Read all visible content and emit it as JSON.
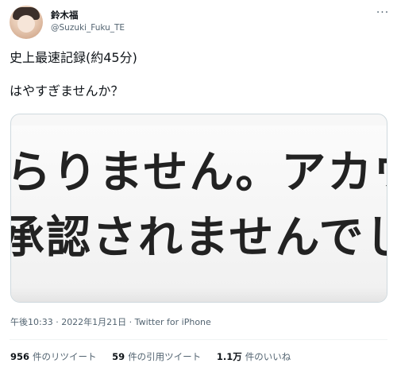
{
  "user": {
    "display_name": "鈴木福",
    "handle": "@Suzuki_Fuku_TE"
  },
  "more_glyph": "···",
  "tweet": {
    "lines": [
      "史上最速記録(約45分)",
      "はやすぎませんか？"
    ]
  },
  "media": {
    "line1": "らりません。アカウン",
    "line2": "承認されませんでした"
  },
  "meta": {
    "timestamp": "午後10:33 · 2022年1月21日 · Twitter for iPhone"
  },
  "stats": {
    "retweets_count": "956",
    "retweets_label": "件のリツイート",
    "quotes_count": "59",
    "quotes_label": "件の引用ツイート",
    "likes_count": "1.1万",
    "likes_label": "件のいいね"
  }
}
